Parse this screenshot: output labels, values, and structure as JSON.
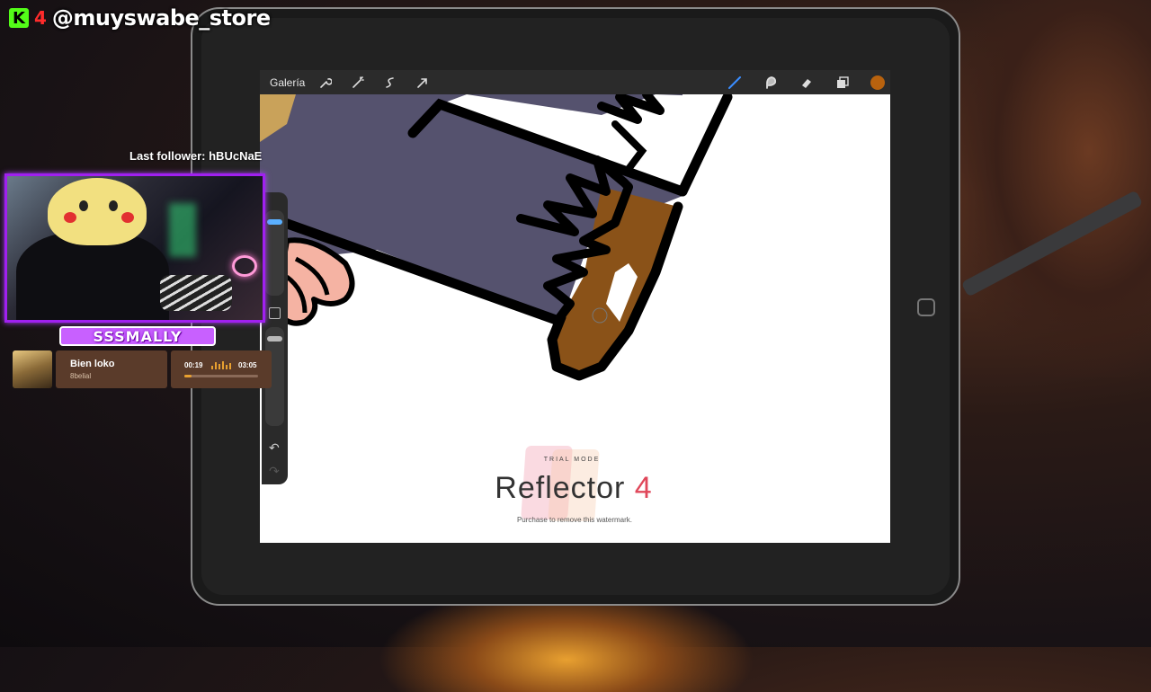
{
  "overlay": {
    "kick_logo": "K",
    "channel_number": "4",
    "handle": "@muyswabe_store",
    "last_follower": "Last follower: hBUcNaE",
    "streamer_name": "SSSMALLY"
  },
  "music": {
    "title": "Bien loko",
    "artist": "8belial",
    "elapsed": "00:19",
    "total": "03:05",
    "progress": 0.1
  },
  "procreate": {
    "gallery_label": "Galería",
    "left_tools": [
      "wrench-icon",
      "magic-wand-icon",
      "selection-icon",
      "transform-arrow-icon"
    ],
    "right_tools": [
      "brush-icon",
      "smudge-icon",
      "eraser-icon",
      "layers-icon"
    ],
    "active_color": "#b8620e"
  },
  "watermark": {
    "trial": "TRIAL MODE",
    "title": "Reflector",
    "version": "4",
    "note": "Purchase to remove this watermark."
  }
}
